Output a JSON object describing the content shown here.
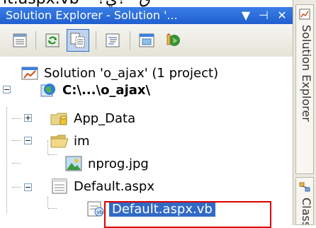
{
  "top_caption": "lt.aspx.vb ^?ق^?ي",
  "window": {
    "title": "Solution Explorer - Solution '...",
    "pin_glyph": "⊣",
    "close_glyph": "✕",
    "dropdown_glyph": "▼"
  },
  "toolbar": {
    "buttons": [
      {
        "name": "properties-button",
        "icon": "properties-icon"
      },
      {
        "name": "refresh-button",
        "icon": "refresh-icon"
      },
      {
        "name": "show-all-files-button",
        "icon": "show-all-files-icon",
        "selected": true
      },
      {
        "name": "view-code-button",
        "icon": "view-code-icon"
      },
      {
        "name": "view-designer-button",
        "icon": "view-designer-icon"
      },
      {
        "name": "class-diagram-button",
        "icon": "class-diagram-icon"
      }
    ]
  },
  "tree": {
    "solution": "Solution 'o_ajax' (1 project)",
    "project": "C:\\...\\o_ajax\\",
    "items": [
      {
        "label": "App_Data",
        "expander": "+"
      },
      {
        "label": "im",
        "expander": "−"
      },
      {
        "label": "nprog.jpg"
      },
      {
        "label": "Default.aspx",
        "expander": "−"
      },
      {
        "label": "Default.aspx.vb",
        "selected": true
      }
    ]
  },
  "dock_tabs": [
    {
      "label": "Solution Explorer",
      "icon": "solution-explorer-icon"
    },
    {
      "label": "Class",
      "icon": "class-view-icon"
    }
  ],
  "colors": {
    "selection": "#316ac5",
    "highlight_box": "#e00000",
    "title_bar": "#2a6ed8"
  }
}
